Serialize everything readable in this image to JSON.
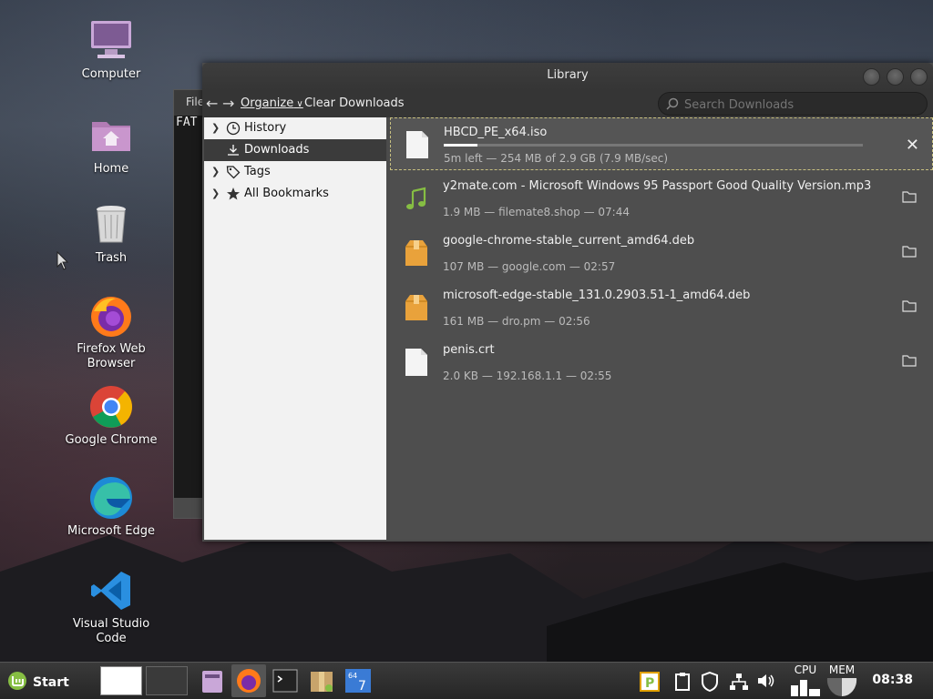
{
  "desktop": {
    "icons": [
      {
        "label": "Computer",
        "icon": "computer-icon"
      },
      {
        "label": "Home",
        "icon": "home-folder-icon"
      },
      {
        "label": "Trash",
        "icon": "trash-icon"
      },
      {
        "label": "Firefox Web Browser",
        "icon": "firefox-icon"
      },
      {
        "label": "Google Chrome",
        "icon": "chrome-icon"
      },
      {
        "label": "Microsoft Edge",
        "icon": "edge-icon"
      },
      {
        "label": "Visual Studio Code",
        "icon": "vscode-icon"
      }
    ]
  },
  "terminal": {
    "title_fragment": "File",
    "text": "FAT"
  },
  "library": {
    "title": "Library",
    "toolbar": {
      "organize": "Organize",
      "clear": "Clear Downloads"
    },
    "search": {
      "placeholder": "Search Downloads"
    },
    "sidebar": [
      {
        "label": "History",
        "icon": "clock-icon"
      },
      {
        "label": "Downloads",
        "icon": "download-icon"
      },
      {
        "label": "Tags",
        "icon": "tag-icon"
      },
      {
        "label": "All Bookmarks",
        "icon": "star-icon"
      }
    ],
    "downloads": [
      {
        "name": "HBCD_PE_x64.iso",
        "status": "5m left — 254 MB of 2.9 GB (7.9 MB/sec)",
        "progress": 0.08
      },
      {
        "name": "y2mate.com - Microsoft Windows 95 Passport Good Quality Version.mp3",
        "status": "1.9 MB — filemate8.shop — 07:44"
      },
      {
        "name": "google-chrome-stable_current_amd64.deb",
        "status": "107 MB — google.com — 02:57"
      },
      {
        "name": "microsoft-edge-stable_131.0.2903.51-1_amd64.deb",
        "status": "161 MB — dro.pm — 02:56"
      },
      {
        "name": "penis.crt",
        "status": "2.0 KB — 192.168.1.1 — 02:55"
      }
    ]
  },
  "taskbar": {
    "start": "Start",
    "cpu": "CPU",
    "mem": "MEM",
    "clock": "08:38"
  },
  "colors": {
    "accent": "#86be43",
    "selection": "#3b3b3b"
  }
}
